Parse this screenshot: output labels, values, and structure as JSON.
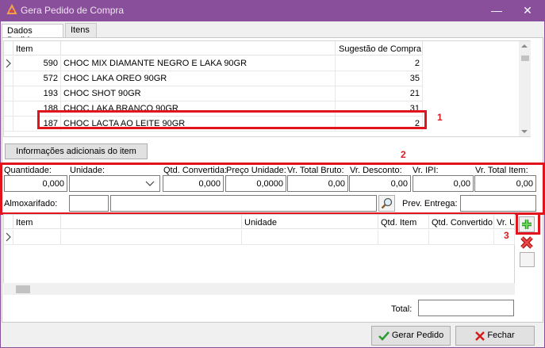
{
  "window": {
    "title": "Gera Pedido de Compra",
    "minimize_glyph": "—",
    "close_glyph": "✕"
  },
  "tabs": [
    {
      "label": "Dados Pedido",
      "active": false
    },
    {
      "label": "Itens",
      "active": true
    }
  ],
  "items_grid": {
    "columns": [
      "Item",
      "Sugestão de Compra"
    ],
    "rows": [
      {
        "code": "590",
        "description": "CHOC MIX DIAMANTE NEGRO E LAKA 90GR",
        "suggestion": "2"
      },
      {
        "code": "572",
        "description": "CHOC LAKA OREO 90GR",
        "suggestion": "35"
      },
      {
        "code": "193",
        "description": "CHOC SHOT 90GR",
        "suggestion": "21"
      },
      {
        "code": "188",
        "description": "CHOC LAKA BRANCO 90GR",
        "suggestion": "31"
      },
      {
        "code": "187",
        "description": "CHOC LACTA AO LEITE 90GR",
        "suggestion": "2"
      }
    ]
  },
  "info_button": "Informações adicionais do item",
  "annotations": [
    "1",
    "2",
    "3"
  ],
  "form": {
    "labels": {
      "quantidade": "Quantidade:",
      "unidade": "Unidade:",
      "qtd_convertida": "Qtd. Convertida:",
      "preco_unidade": "Preço Unidade:",
      "vr_total_bruto": "Vr. Total Bruto:",
      "vr_desconto": "Vr. Desconto:",
      "vr_ipi": "Vr. IPI:",
      "vr_total_item": "Vr. Total Item:",
      "almoxarifado": "Almoxarifado:",
      "prev_entrega": "Prev. Entrega:"
    },
    "values": {
      "quantidade": "0,000",
      "unidade": "",
      "qtd_convertida": "0,000",
      "preco_unidade": "0,0000",
      "vr_total_bruto": "0,00",
      "vr_desconto": "0,00",
      "vr_ipi": "0,00",
      "vr_total_item": "0,00",
      "almoxarifado_code": "",
      "almoxarifado_name": "",
      "prev_entrega": ""
    }
  },
  "order_grid": {
    "columns": [
      "Item",
      "Unidade",
      "Qtd. Item",
      "Qtd. Convertido",
      "Vr. U"
    ]
  },
  "total_label": "Total:",
  "total_value": "",
  "buttons": {
    "gerar_pedido": "Gerar Pedido",
    "fechar": "Fechar"
  },
  "colors": {
    "title_bar": "#8a4f9a",
    "highlight_red": "#e1131c"
  }
}
